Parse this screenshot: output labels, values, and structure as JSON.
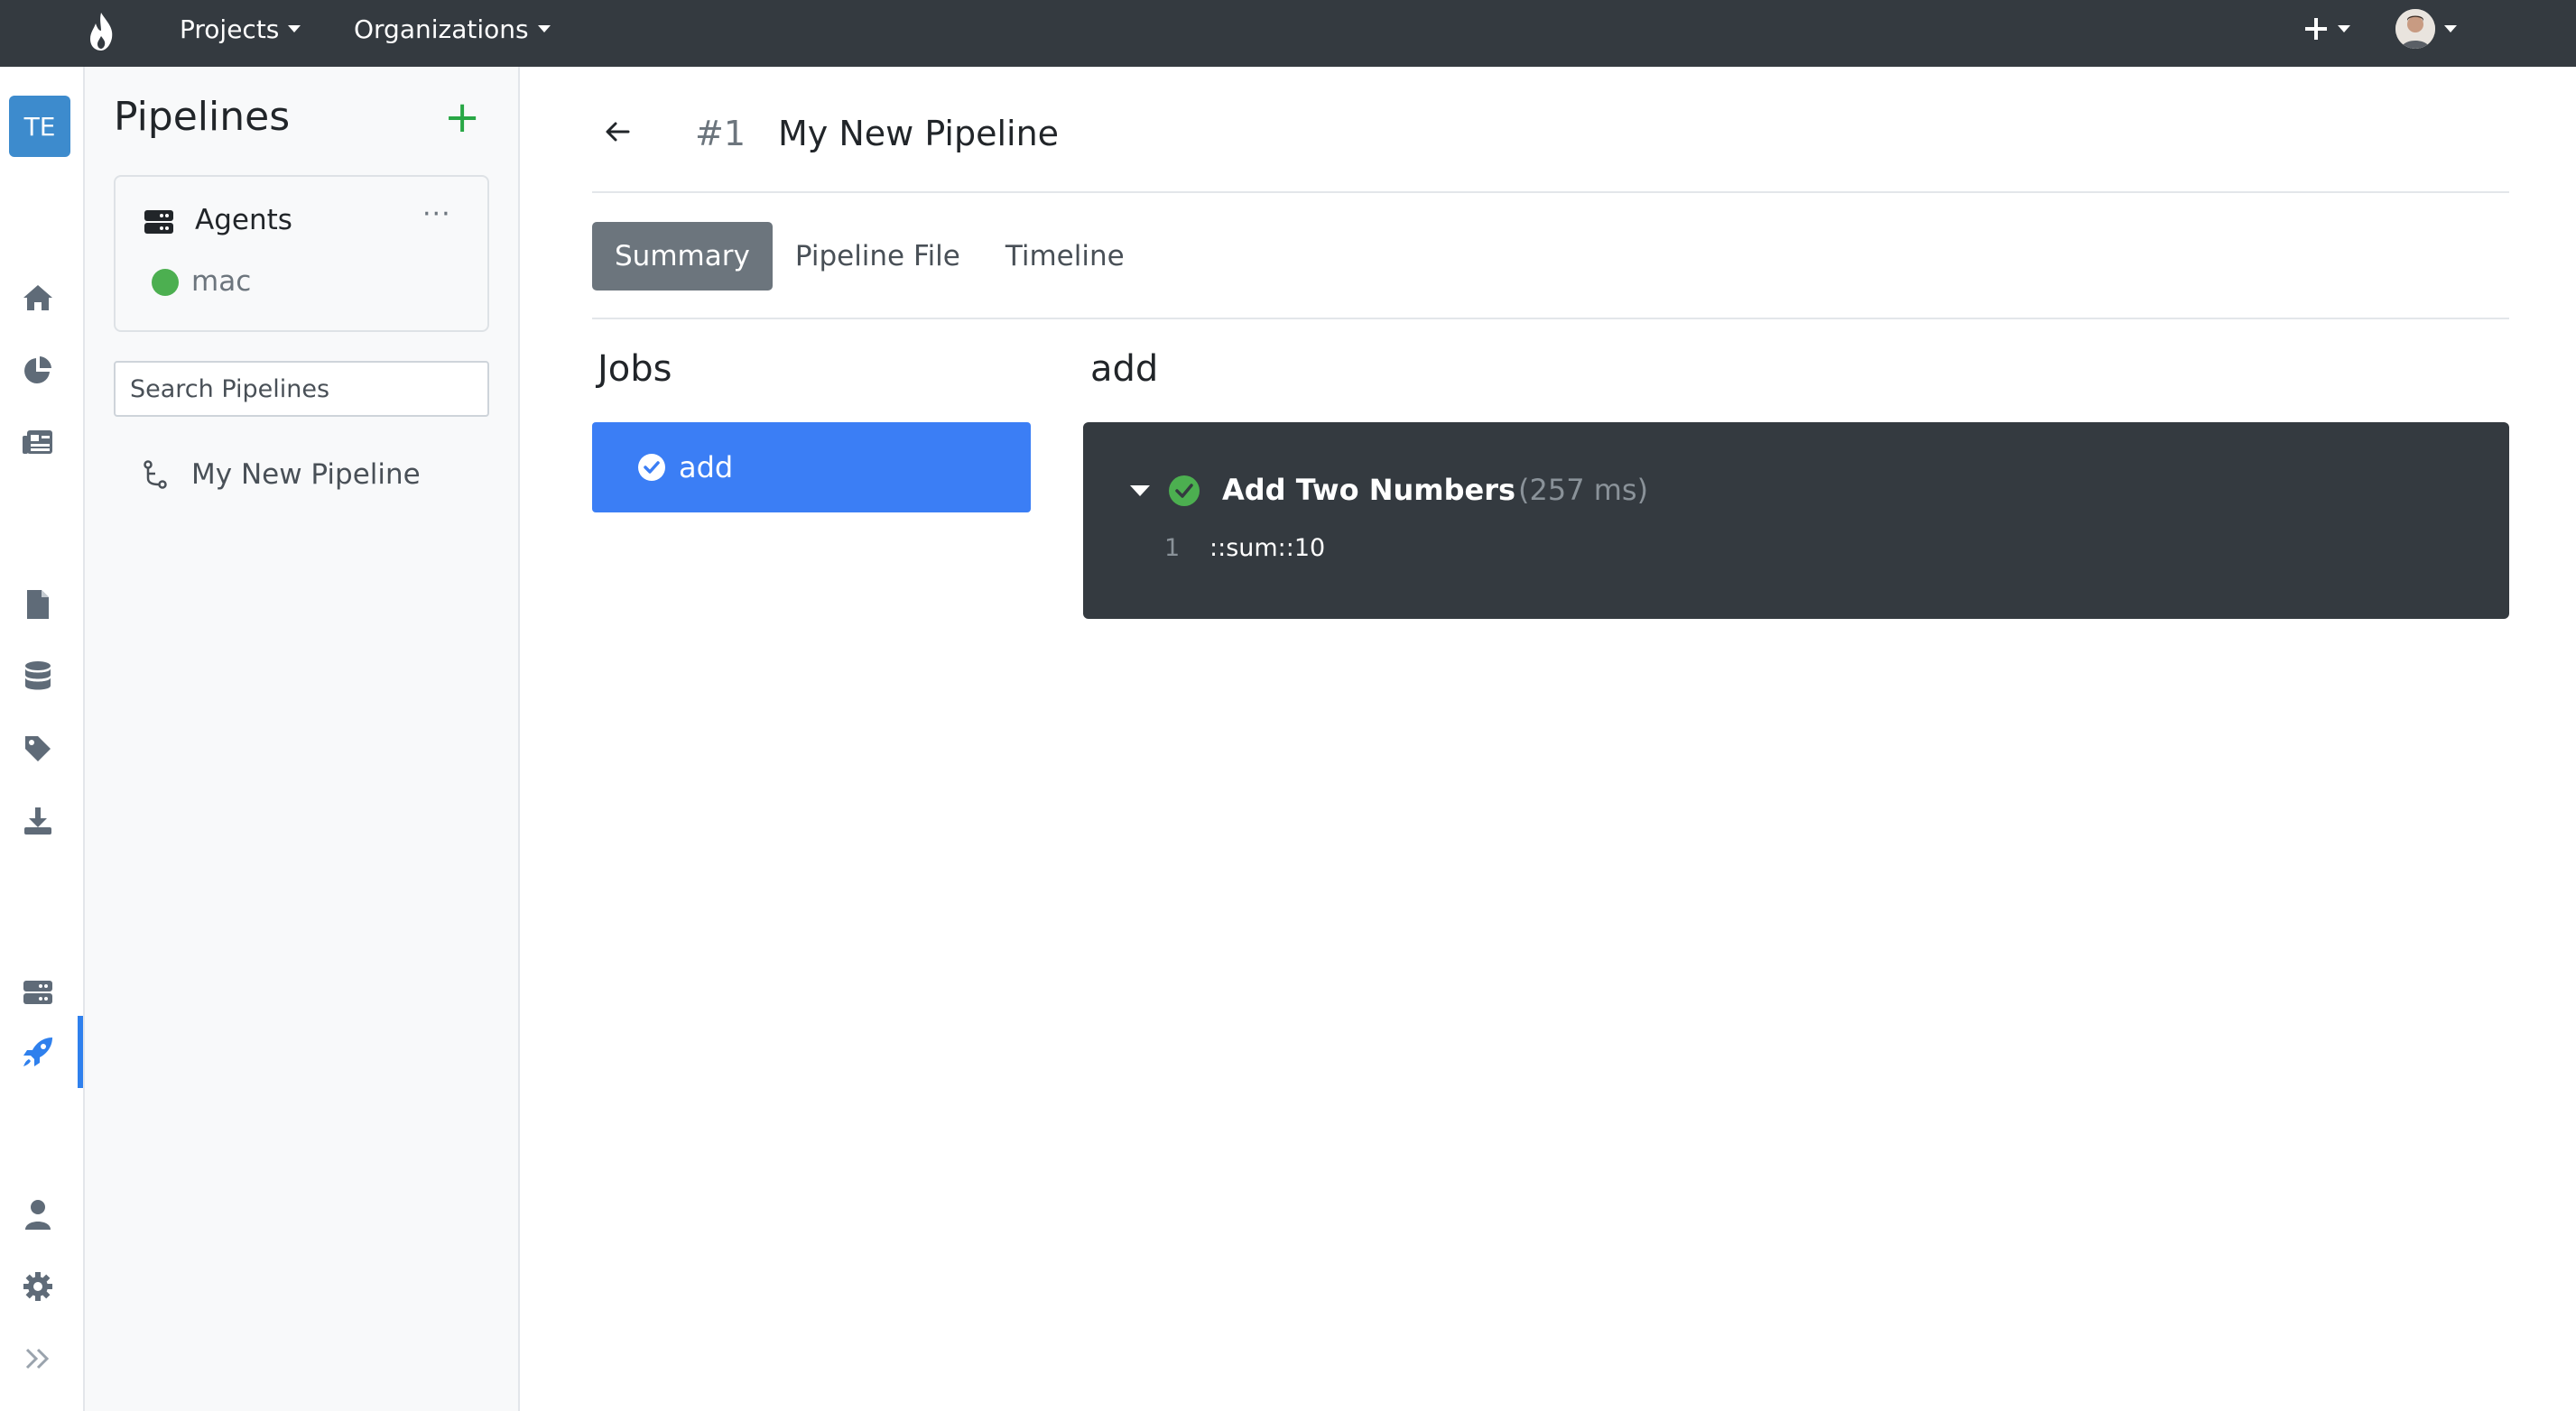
{
  "topbar": {
    "projects_label": "Projects",
    "organizations_label": "Organizations"
  },
  "rail": {
    "project_badge": "TE",
    "icons": [
      "home-icon",
      "chart-pie-icon",
      "newspaper-icon",
      "file-icon",
      "database-icon",
      "tag-icon",
      "download-icon",
      "server-icon",
      "rocket-icon",
      "user-icon",
      "gear-icon",
      "expand-icon"
    ],
    "active": "rocket-icon",
    "accent_color": "#2f80ed"
  },
  "sidebar": {
    "title": "Pipelines",
    "add_label": "+",
    "agents": {
      "label": "Agents",
      "more_label": "···",
      "items": [
        {
          "name": "mac",
          "status_color": "#4caf50"
        }
      ]
    },
    "search": {
      "placeholder": "Search Pipelines",
      "value": ""
    },
    "pipelines": [
      {
        "label": "My New Pipeline"
      }
    ]
  },
  "main": {
    "run_number": "#1",
    "title": "My New Pipeline",
    "tabs": [
      {
        "label": "Summary",
        "active": true
      },
      {
        "label": "Pipeline File",
        "active": false
      },
      {
        "label": "Timeline",
        "active": false
      }
    ],
    "jobs_heading": "Jobs",
    "jobs": [
      {
        "label": "add",
        "status": "success",
        "color": "#3b7ef5"
      }
    ],
    "selected_job": {
      "heading": "add",
      "steps": [
        {
          "name": "Add Two Numbers",
          "duration": "(257 ms)",
          "status_color": "#4caf50",
          "lines": [
            {
              "number": "1",
              "text": "::sum::10"
            }
          ]
        }
      ]
    }
  }
}
